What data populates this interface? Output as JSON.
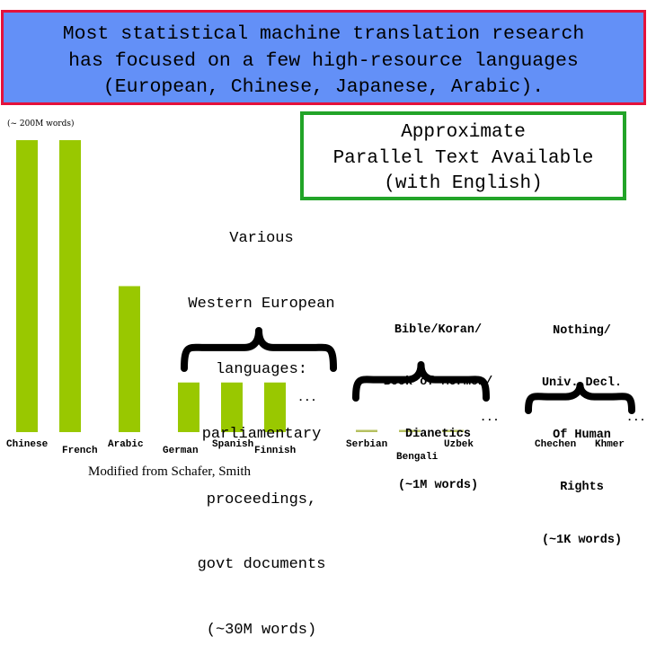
{
  "title": {
    "lines": [
      "Most statistical machine translation research",
      "has focused on a few high-resource languages",
      "(European, Chinese, Japanese, Arabic)."
    ],
    "colors": {
      "fill": "#6390f7",
      "border": "#e4123b"
    }
  },
  "legend_box": {
    "lines": [
      "Approximate",
      "Parallel Text Available",
      "(with English)"
    ],
    "border_color": "#22a428"
  },
  "scale_note": "(~ 200M words)",
  "source": "Modified from Schafer, Smith",
  "chart_data": {
    "type": "bar",
    "title": "Approximate Parallel Text Available (with English)",
    "xlabel": "",
    "ylabel": "",
    "unit": "words (approximate)",
    "ylim": [
      0,
      200000000
    ],
    "bar_color": "#99c800",
    "tiny_bar_color": "#b5c060",
    "categories": [
      "Chinese",
      "French",
      "Arabic",
      "German",
      "Spanish",
      "Finnish",
      "Serbian",
      "Bengali",
      "Uzbek",
      "Chechen",
      "Khmer"
    ],
    "values": [
      200000000,
      200000000,
      100000000,
      34000000,
      34000000,
      34000000,
      1000000,
      1000000,
      1000000,
      1000,
      1000
    ],
    "groups": [
      {
        "name": "Various Western European languages",
        "lines": [
          "Various",
          "Western European",
          "languages:",
          "parliamentary",
          "proceedings,",
          "govt documents",
          "(~30M words)"
        ],
        "members": [
          "German",
          "Spanish",
          "Finnish"
        ],
        "approx_words": "~30M",
        "more": "..."
      },
      {
        "name": "Bible/Koran/Book of Mormon/Dianetics",
        "lines": [
          "Bible/Koran/",
          "Book of Mormon/",
          "Dianetics",
          "(~1M words)"
        ],
        "members": [
          "Serbian",
          "Bengali",
          "Uzbek"
        ],
        "approx_words": "~1M",
        "more": "..."
      },
      {
        "name": "Nothing/Univ. Decl. Of Human Rights",
        "lines": [
          "Nothing/",
          "Univ. Decl.",
          "Of Human",
          "Rights",
          "(~1K words)"
        ],
        "members": [
          "Chechen",
          "Khmer"
        ],
        "approx_words": "~1K",
        "more": "..."
      }
    ]
  }
}
